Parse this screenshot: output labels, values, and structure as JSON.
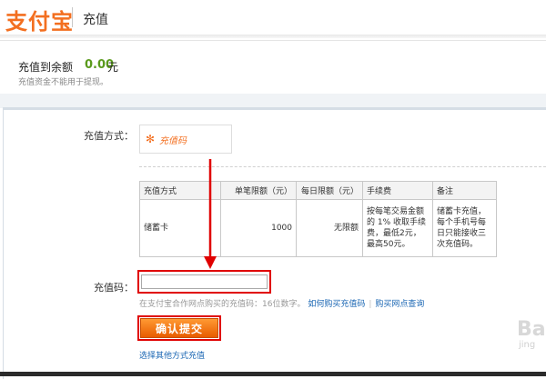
{
  "header": {
    "logo_text": "支付宝",
    "title": "充值"
  },
  "balance": {
    "label": "充值到余额",
    "amount": "0.00",
    "unit": "元",
    "note": "充值资金不能用于提现。"
  },
  "form": {
    "method_label": "充值方式：",
    "method_option": "充值码",
    "table": {
      "headers": [
        "充值方式",
        "单笔限额（元）",
        "每日限额（元）",
        "手续费",
        "备注"
      ],
      "row": {
        "method": "储蓄卡",
        "single_limit": "1000",
        "daily_limit": "无限额",
        "fee": "按每笔交易金额的 1% 收取手续费，最低2元，最高50元。",
        "remark": "储蓄卡充值，每个手机号每日只能接收三次充值码。"
      }
    },
    "code_label": "充值码：",
    "code_value": "",
    "hint_text": "在支付宝合作网点购买的充值码：16位数字。",
    "hint_link1": "如何购买充值码",
    "hint_link2": "购买网点查询",
    "submit_label": "确认提交",
    "other_link": "选择其他方式充值"
  },
  "watermark": {
    "main": "Ba",
    "sub": "jing"
  },
  "colors": {
    "brand": "#f36f20",
    "highlight": "#e00000",
    "link": "#1a66b3",
    "amount": "#5a9a1c"
  }
}
